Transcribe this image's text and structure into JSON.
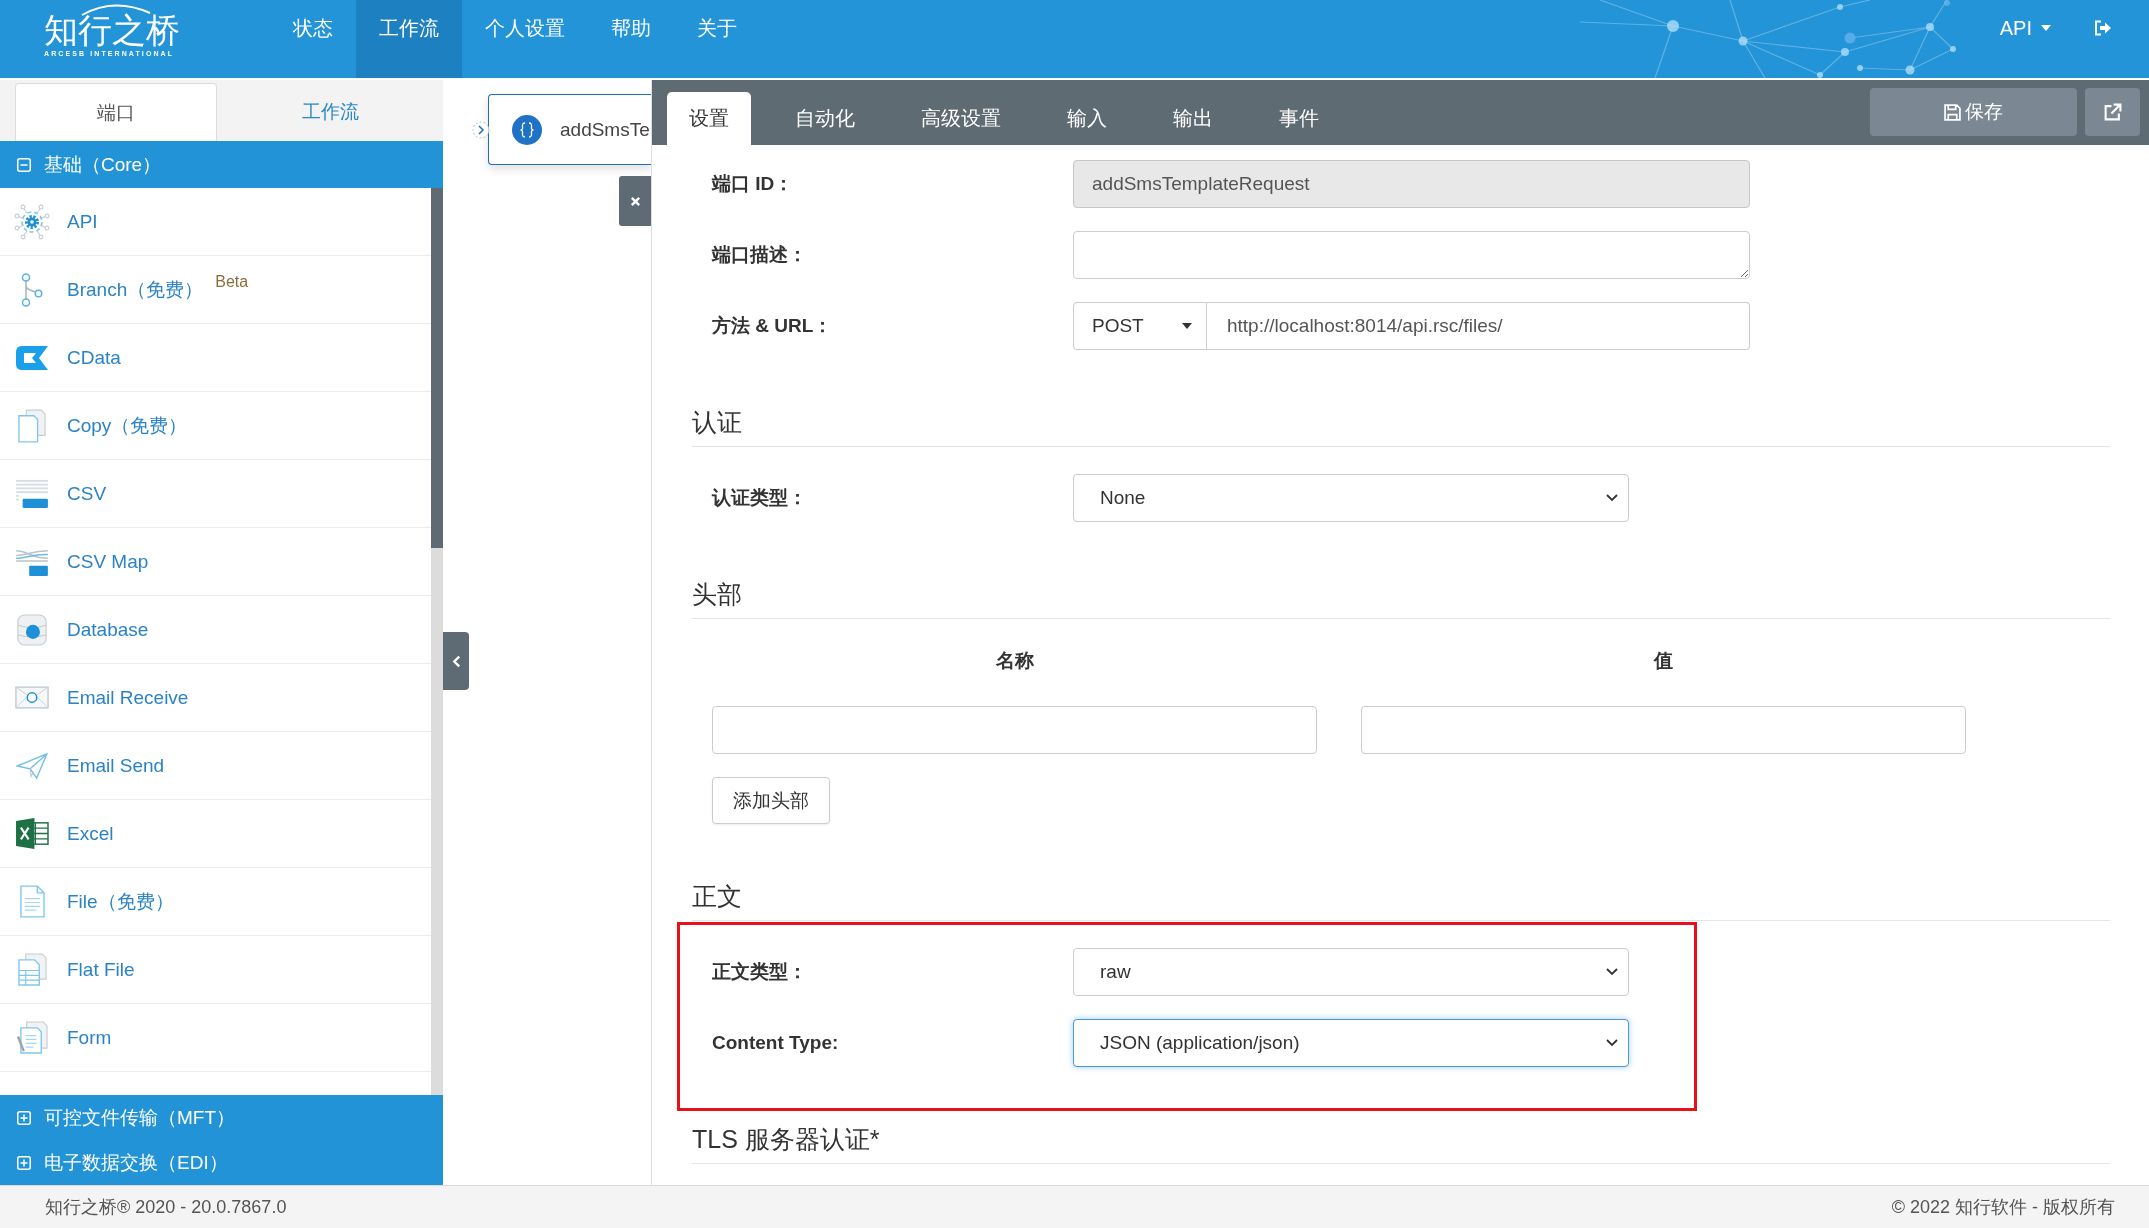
{
  "navbar": {
    "logo": {
      "title": "知行之桥",
      "subtitle": "ARCESB INTERNATIONAL"
    },
    "menu": [
      {
        "label": "状态",
        "selected": false
      },
      {
        "label": "工作流",
        "selected": true
      },
      {
        "label": "个人设置",
        "selected": false
      },
      {
        "label": "帮助",
        "selected": false
      },
      {
        "label": "关于",
        "selected": false
      }
    ],
    "user_menu": {
      "label": "API"
    }
  },
  "sidebar": {
    "tabs": [
      {
        "label": "端口",
        "selected": true
      },
      {
        "label": "工作流",
        "selected": false
      }
    ],
    "groups": [
      {
        "label": "基础（Core）",
        "expanded": true,
        "items": [
          {
            "label": "API"
          },
          {
            "label": "Branch（免费）",
            "badge": "Beta"
          },
          {
            "label": "CData"
          },
          {
            "label": "Copy（免费）"
          },
          {
            "label": "CSV"
          },
          {
            "label": "CSV Map"
          },
          {
            "label": "Database"
          },
          {
            "label": "Email Receive"
          },
          {
            "label": "Email Send"
          },
          {
            "label": "Excel"
          },
          {
            "label": "File（免费）"
          },
          {
            "label": "Flat File"
          },
          {
            "label": "Form"
          }
        ]
      },
      {
        "label": "可控文件传输（MFT）",
        "expanded": false
      },
      {
        "label": "电子数据交换（EDI）",
        "expanded": false
      }
    ]
  },
  "canvas": {
    "node": {
      "label": "addSmsTe"
    }
  },
  "panel": {
    "tabs": [
      {
        "label": "设置",
        "selected": true
      },
      {
        "label": "自动化",
        "selected": false
      },
      {
        "label": "高级设置",
        "selected": false
      },
      {
        "label": "输入",
        "selected": false
      },
      {
        "label": "输出",
        "selected": false
      },
      {
        "label": "事件",
        "selected": false
      }
    ],
    "save_button": {
      "label": "保存"
    },
    "fields": [
      {
        "kind": "text",
        "label": "端口 ID：",
        "value": "addSmsTemplateRequest",
        "disabled": true
      },
      {
        "kind": "textarea",
        "label": "端口描述：",
        "disabled": false
      },
      {
        "kind": "method_url",
        "label": "方法 & URL：",
        "method": "POST",
        "value": "http://localhost:8014/api.rsc/files/",
        "disabled": false
      }
    ],
    "sections": [
      {
        "kind": "fields",
        "title": "认证",
        "fields": [
          {
            "label": "认证类型：",
            "value": "None",
            "focused": false
          }
        ]
      },
      {
        "kind": "headers",
        "title": "头部",
        "columns": [
          "名称",
          "值"
        ],
        "add_button": "添加头部"
      },
      {
        "kind": "fields",
        "title": "正文",
        "highlighted": true,
        "fields": [
          {
            "label": "正文类型：",
            "value": "raw",
            "focused": false
          },
          {
            "label": "Content Type:",
            "value": "JSON (application/json)",
            "focused": true
          }
        ]
      },
      {
        "kind": "heading",
        "title": "TLS 服务器认证*"
      }
    ]
  },
  "footer": {
    "version": "知行之桥® 2020 - 20.0.7867.0",
    "copyright": "© 2022 知行软件 - 版权所有"
  }
}
